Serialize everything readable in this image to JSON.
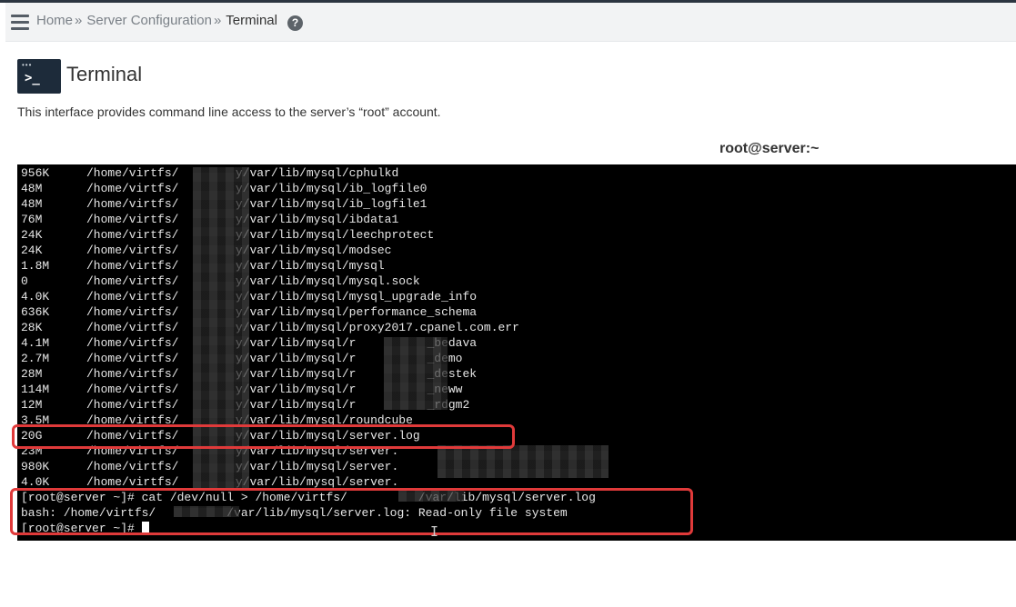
{
  "breadcrumb": {
    "home": "Home",
    "separator": "»",
    "section": "Server Configuration",
    "current": "Terminal",
    "help_icon": "?"
  },
  "icons": {
    "menu": "hamburger-menu-icon",
    "help": "question-circle-icon",
    "app": "terminal-app-icon"
  },
  "app_icon": {
    "dots": "•••",
    "prompt": ">_"
  },
  "page": {
    "title": "Terminal",
    "description": "This interface provides command line access to the server’s “root” account."
  },
  "terminal": {
    "title": "root@server:~",
    "colors": {
      "background": "#000000",
      "text": "#e6e6e6",
      "highlight": "#e03a3a"
    },
    "listing": [
      {
        "size": "956K",
        "path": "/home/virtfs/",
        "suffix": "y/var/lib/mysql/cphulkd"
      },
      {
        "size": "48M",
        "path": "/home/virtfs/",
        "suffix": "y/var/lib/mysql/ib_logfile0"
      },
      {
        "size": "48M",
        "path": "/home/virtfs/",
        "suffix": "y/var/lib/mysql/ib_logfile1"
      },
      {
        "size": "76M",
        "path": "/home/virtfs/",
        "suffix": "y/var/lib/mysql/ibdata1"
      },
      {
        "size": "24K",
        "path": "/home/virtfs/",
        "suffix": "y/var/lib/mysql/leechprotect"
      },
      {
        "size": "24K",
        "path": "/home/virtfs/",
        "suffix": "y/var/lib/mysql/modsec"
      },
      {
        "size": "1.8M",
        "path": "/home/virtfs/",
        "suffix": "y/var/lib/mysql/mysql"
      },
      {
        "size": "0",
        "path": "/home/virtfs/",
        "suffix": "y/var/lib/mysql/mysql.sock"
      },
      {
        "size": "4.0K",
        "path": "/home/virtfs/",
        "suffix": "y/var/lib/mysql/mysql_upgrade_info"
      },
      {
        "size": "636K",
        "path": "/home/virtfs/",
        "suffix": "y/var/lib/mysql/performance_schema"
      },
      {
        "size": "28K",
        "path": "/home/virtfs/",
        "suffix": "y/var/lib/mysql/proxy2017.cpanel.com.err"
      },
      {
        "size": "4.1M",
        "path": "/home/virtfs/",
        "suffix": "y/var/lib/mysql/r          _bedava"
      },
      {
        "size": "2.7M",
        "path": "/home/virtfs/",
        "suffix": "y/var/lib/mysql/r          _demo"
      },
      {
        "size": "28M",
        "path": "/home/virtfs/",
        "suffix": "y/var/lib/mysql/r          _destek"
      },
      {
        "size": "114M",
        "path": "/home/virtfs/",
        "suffix": "y/var/lib/mysql/r          _neww"
      },
      {
        "size": "12M",
        "path": "/home/virtfs/",
        "suffix": "y/var/lib/mysql/r          _rdgm2"
      },
      {
        "size": "3.5M",
        "path": "/home/virtfs/",
        "suffix": "y/var/lib/mysql/roundcube"
      },
      {
        "size": "20G",
        "path": "/home/virtfs/",
        "suffix": "y/var/lib/mysql/server.log"
      },
      {
        "size": "23M",
        "path": "/home/virtfs/",
        "suffix": "y/var/lib/mysql/server."
      },
      {
        "size": "980K",
        "path": "/home/virtfs/",
        "suffix": "y/var/lib/mysql/server."
      },
      {
        "size": "4.0K",
        "path": "/home/virtfs/",
        "suffix": "y/var/lib/mysql/server."
      }
    ],
    "command_line": "[root@server ~]# cat /dev/null > /home/virtfs/          /var/lib/mysql/server.log",
    "error_line": "bash: /home/virtfs/          /var/lib/mysql/server.log: Read-only file system",
    "prompt_line": "[root@server ~]# "
  }
}
